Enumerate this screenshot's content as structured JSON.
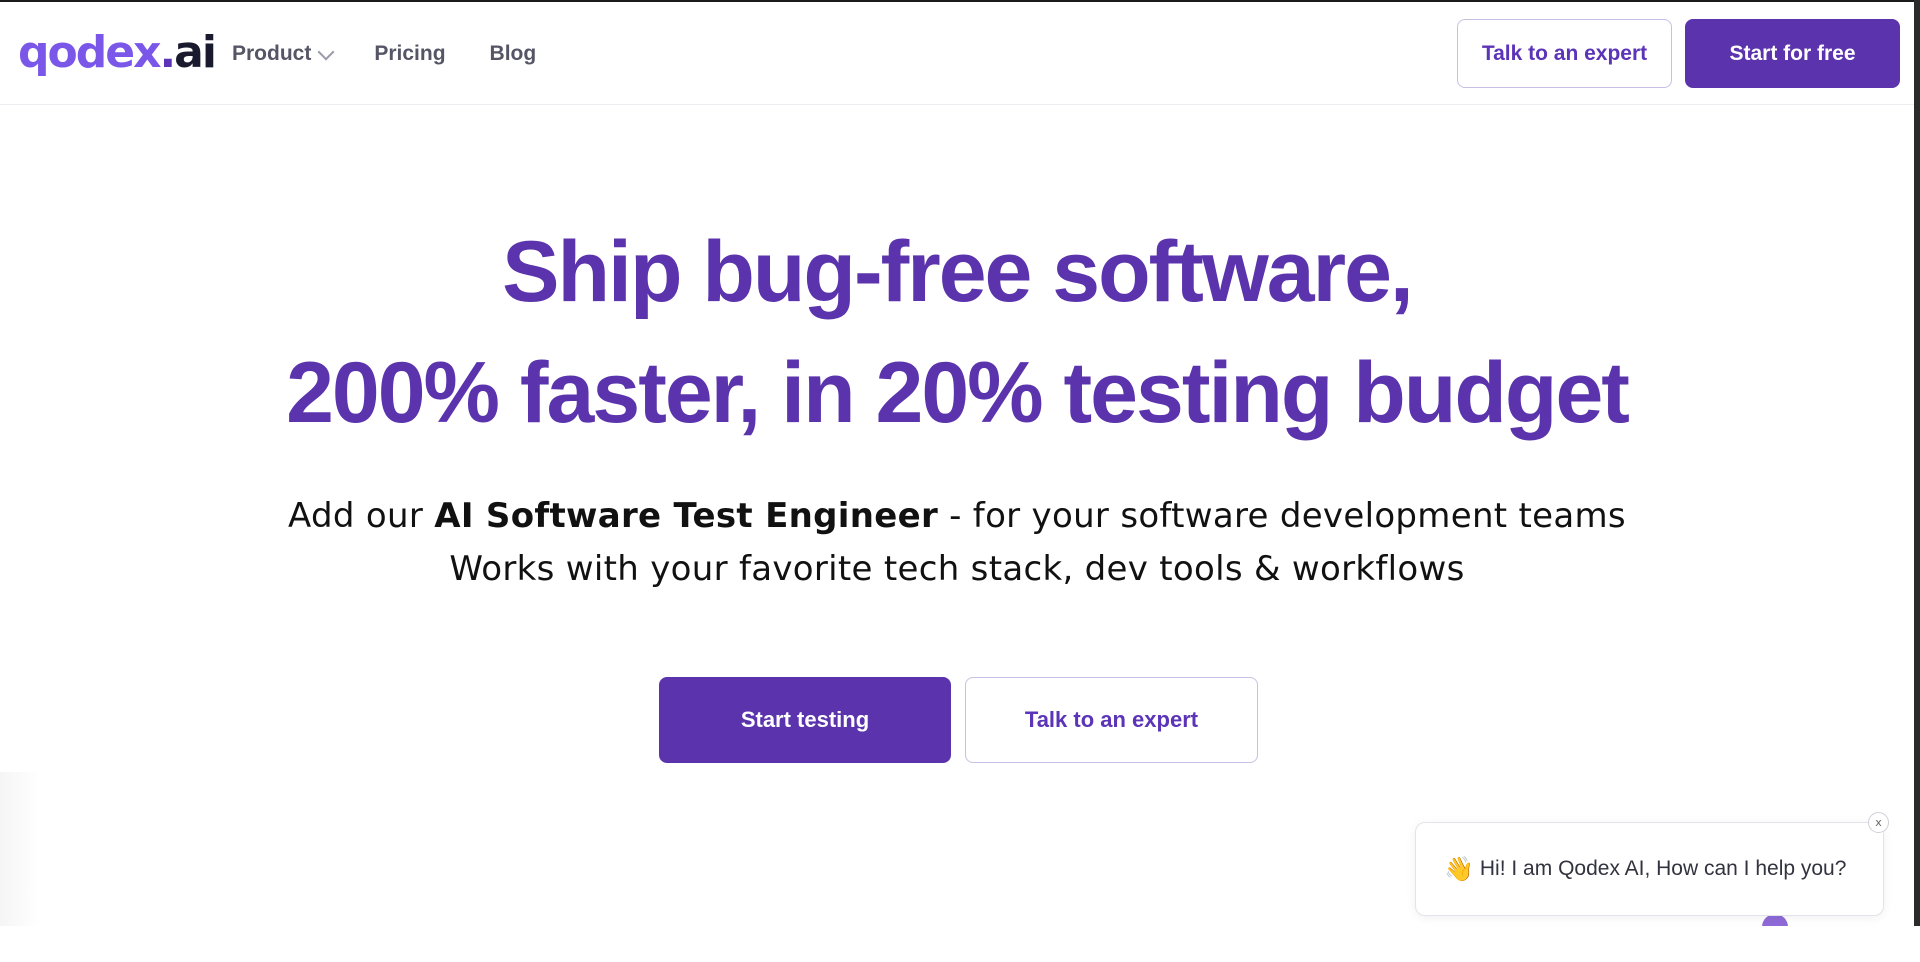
{
  "nav": {
    "logo": {
      "part1": "qodex",
      "dot": ".",
      "part2": "ai"
    },
    "links": [
      {
        "label": "Product"
      },
      {
        "label": "Pricing"
      },
      {
        "label": "Blog"
      }
    ],
    "talk_to_expert": "Talk to an expert",
    "start_for_free": "Start for free"
  },
  "hero": {
    "title_line1": "Ship bug-free software,",
    "title_line2": "200% faster, in 20% testing budget",
    "sub1_prefix": "Add our ",
    "sub1_bold": "AI Software Test Engineer",
    "sub1_suffix": " - for your software development teams",
    "sub2": "Works with your favorite tech stack, dev tools & workflows",
    "cta_primary": "Start testing",
    "cta_secondary": "Talk to an expert"
  },
  "chat": {
    "emoji": "👋",
    "message": " Hi! I am Qodex AI, How can I help you?",
    "close": "x"
  },
  "colors": {
    "brand_purple": "#5b33ad",
    "logo_light_purple": "#7a57e8",
    "nav_text": "#555566"
  },
  "icons": [
    "chevron-down-icon",
    "waving-hand-icon",
    "close-icon"
  ]
}
